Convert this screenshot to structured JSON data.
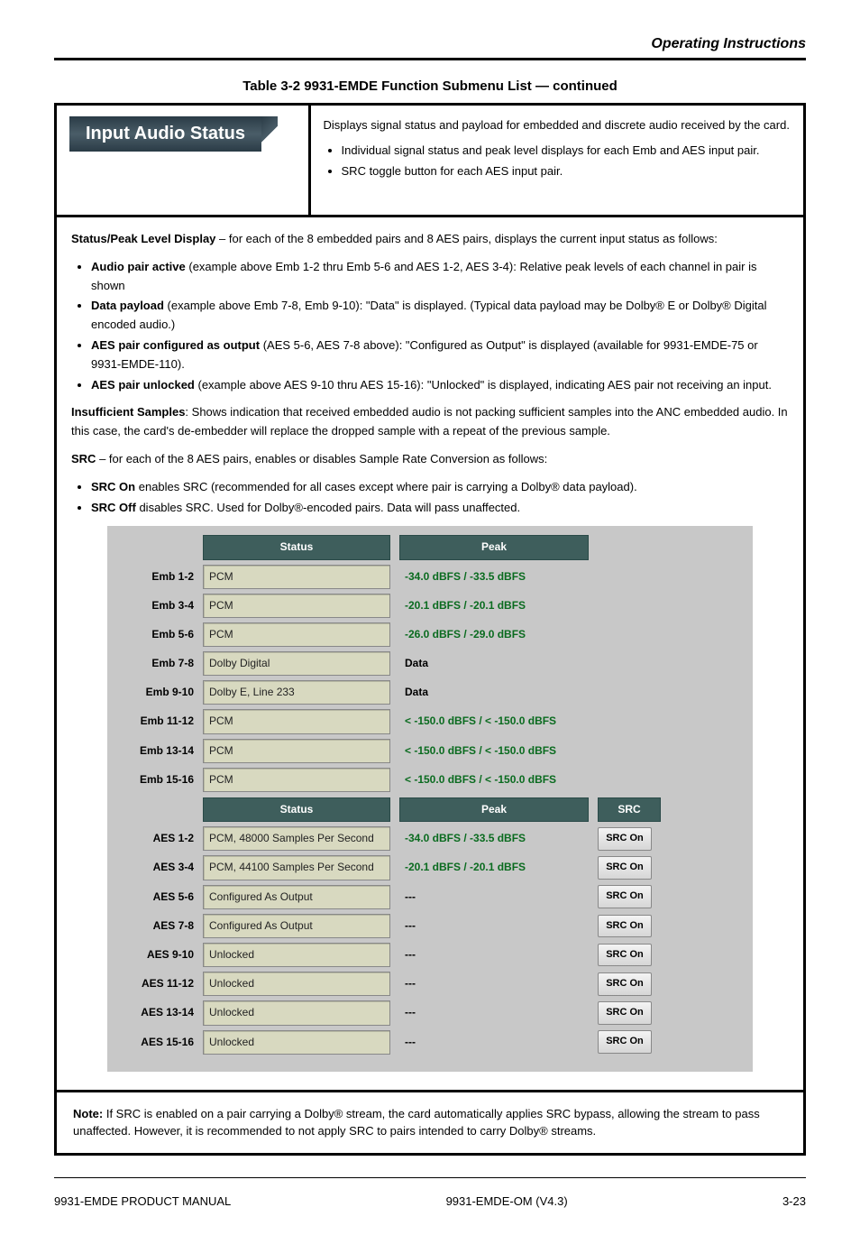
{
  "page": {
    "top_right": "Operating Instructions",
    "caption": "Table 3-2  9931-EMDE Function Submenu List — continued",
    "tab_label": "Input Audio Status",
    "head_lead": "Displays signal status and payload for embedded and discrete audio received by the card.",
    "head_bullets": [
      "Individual signal status and peak level displays for each Emb and AES input pair.",
      "SRC toggle button for each AES input pair."
    ]
  },
  "section": {
    "p1_lead": "Status/Peak Level Display",
    "p1_body": " – for each of the 8 embedded pairs and 8 AES pairs, displays the current input status as follows:",
    "li1_lead": "Audio pair active",
    "li1_body": " (example above Emb 1-2 thru Emb 5-6 and AES 1-2, AES 3-4): Relative peak levels of each channel in pair is shown",
    "li2_lead": "Data payload",
    "li2_body": " (example above Emb 7-8, Emb 9-10): \"Data\" is displayed. (Typical data payload may be Dolby® E or Dolby® Digital encoded audio.)",
    "li3_lead": "AES pair configured as output",
    "li3_body": " (AES 5-6, AES 7-8 above): \"Configured as Output\" is displayed (available for 9931-EMDE-75 or 9931-EMDE-110).",
    "li4_lead": "AES pair unlocked",
    "li4_body": " (example above AES 9-10 thru AES 15-16): \"Unlocked\" is displayed, indicating AES pair not receiving an input.",
    "insuff_lead": "Insufficient Samples",
    "insuff_body": ": Shows indication that received embedded audio is not packing sufficient samples into the ANC embedded audio. In this case, the card's de-embedder will replace the dropped sample with a repeat of the previous sample.",
    "p2_lead": "SRC",
    "p2_body": " – for each of the 8 AES pairs, enables or disables Sample Rate Conversion as follows:",
    "src_li1_lead": "SRC On",
    "src_li1_body": " enables SRC (recommended for all cases except where pair is carrying a Dolby® data payload).",
    "src_li2_lead": "SRC Off",
    "src_li2_body": " disables SRC. Used for Dolby®-encoded pairs. Data will pass unaffected."
  },
  "panel": {
    "hdr_status": "Status",
    "hdr_peak": "Peak",
    "hdr_src": "SRC",
    "emb": [
      {
        "label": "Emb 1-2",
        "status": "PCM",
        "peak": "-34.0 dBFS / -33.5 dBFS",
        "pclass": "green"
      },
      {
        "label": "Emb 3-4",
        "status": "PCM",
        "peak": "-20.1 dBFS / -20.1 dBFS",
        "pclass": "green"
      },
      {
        "label": "Emb 5-6",
        "status": "PCM",
        "peak": "-26.0 dBFS / -29.0 dBFS",
        "pclass": "green"
      },
      {
        "label": "Emb 7-8",
        "status": "Dolby Digital",
        "peak": "Data",
        "pclass": "black"
      },
      {
        "label": "Emb 9-10",
        "status": "Dolby E, Line 233",
        "peak": "Data",
        "pclass": "black"
      },
      {
        "label": "Emb 11-12",
        "status": "PCM",
        "peak": "< -150.0 dBFS / < -150.0 dBFS",
        "pclass": "green"
      },
      {
        "label": "Emb 13-14",
        "status": "PCM",
        "peak": "< -150.0 dBFS / < -150.0 dBFS",
        "pclass": "green"
      },
      {
        "label": "Emb 15-16",
        "status": "PCM",
        "peak": "< -150.0 dBFS / < -150.0 dBFS",
        "pclass": "green"
      }
    ],
    "aes": [
      {
        "label": "AES 1-2",
        "status": "PCM, 48000 Samples Per Second",
        "peak": "-34.0 dBFS / -33.5 dBFS",
        "pclass": "green",
        "src": "SRC On"
      },
      {
        "label": "AES 3-4",
        "status": "PCM, 44100 Samples Per Second",
        "peak": "-20.1 dBFS / -20.1 dBFS",
        "pclass": "green",
        "src": "SRC On"
      },
      {
        "label": "AES 5-6",
        "status": "Configured As Output",
        "peak": "---",
        "pclass": "black",
        "src": "SRC On"
      },
      {
        "label": "AES 7-8",
        "status": "Configured As Output",
        "peak": "---",
        "pclass": "black",
        "src": "SRC On"
      },
      {
        "label": "AES 9-10",
        "status": "Unlocked",
        "peak": "---",
        "pclass": "black",
        "src": "SRC On"
      },
      {
        "label": "AES 11-12",
        "status": "Unlocked",
        "peak": "---",
        "pclass": "black",
        "src": "SRC On"
      },
      {
        "label": "AES 13-14",
        "status": "Unlocked",
        "peak": "---",
        "pclass": "black",
        "src": "SRC On"
      },
      {
        "label": "AES 15-16",
        "status": "Unlocked",
        "peak": "---",
        "pclass": "black",
        "src": "SRC On"
      }
    ]
  },
  "note": {
    "lead": "Note:",
    "body": " If SRC is enabled on a pair carrying a Dolby® stream, the card automatically applies SRC bypass, allowing the stream to pass unaffected. However, it is recommended to not apply SRC to pairs intended to carry Dolby® streams."
  },
  "footer": {
    "left": "9931-EMDE PRODUCT MANUAL",
    "center": "9931-EMDE-OM (V4.3)",
    "right": "3-23"
  }
}
